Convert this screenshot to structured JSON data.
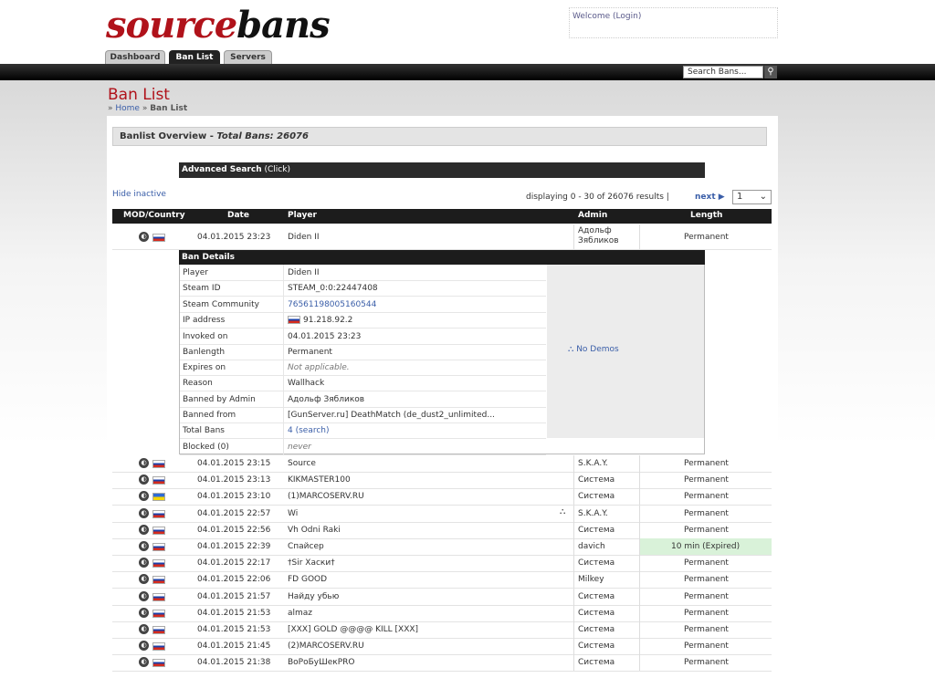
{
  "header": {
    "logo_part1": "source",
    "logo_part2": "bans",
    "welcome_prefix": "Welcome",
    "login_label": "(Login)",
    "tabs": [
      "Dashboard",
      "Ban List",
      "Servers"
    ],
    "search_placeholder": "Search Bans...",
    "search_icon": "magnifier-icon"
  },
  "page": {
    "title": "Ban List",
    "breadcrumb_home": "Home",
    "breadcrumb_current": "Ban List"
  },
  "overview": {
    "label": "Banlist Overview",
    "dash": " - ",
    "total": "Total Bans: 26076"
  },
  "advanced_search": {
    "label": "Advanced Search",
    "hint": "(Click)"
  },
  "controls": {
    "hide_inactive": "Hide inactive",
    "displaying": "displaying 0 - 30 of 26076 results |",
    "next": "next",
    "page_value": "1"
  },
  "table": {
    "headers": [
      "MOD/Country",
      "Date",
      "Player",
      "Admin",
      "Length"
    ],
    "first_row": {
      "flag": "ru",
      "date": "04.01.2015 23:23",
      "player": "Diden II",
      "admin": "Адольф Зябликов",
      "length": "Permanent"
    },
    "rows": [
      {
        "flag": "ru",
        "date": "04.01.2015 23:15",
        "player": "Source",
        "admin": "S.K.A.Y.",
        "length": "Permanent",
        "demo": false,
        "expired": false
      },
      {
        "flag": "ru",
        "date": "04.01.2015 23:13",
        "player": "KIKMASTER100",
        "admin": "Система",
        "length": "Permanent",
        "demo": false,
        "expired": false
      },
      {
        "flag": "ua",
        "date": "04.01.2015 23:10",
        "player": "(1)MARCOSERV.RU",
        "admin": "Система",
        "length": "Permanent",
        "demo": false,
        "expired": false
      },
      {
        "flag": "ru",
        "date": "04.01.2015 22:57",
        "player": "Wi",
        "admin": "S.K.A.Y.",
        "length": "Permanent",
        "demo": true,
        "expired": false
      },
      {
        "flag": "ru",
        "date": "04.01.2015 22:56",
        "player": "Vh Odni Raki",
        "admin": "Система",
        "length": "Permanent",
        "demo": false,
        "expired": false
      },
      {
        "flag": "ru",
        "date": "04.01.2015 22:39",
        "player": "Спайсер",
        "admin": "davich",
        "length": "10 min (Expired)",
        "demo": false,
        "expired": true
      },
      {
        "flag": "ru",
        "date": "04.01.2015 22:17",
        "player": "†Sir Хаски†",
        "admin": "Система",
        "length": "Permanent",
        "demo": false,
        "expired": false
      },
      {
        "flag": "ru",
        "date": "04.01.2015 22:06",
        "player": "FD GOOD",
        "admin": "Milkey",
        "length": "Permanent",
        "demo": false,
        "expired": false
      },
      {
        "flag": "ru",
        "date": "04.01.2015 21:57",
        "player": "Найду убью",
        "admin": "Система",
        "length": "Permanent",
        "demo": false,
        "expired": false
      },
      {
        "flag": "ru",
        "date": "04.01.2015 21:53",
        "player": "almaz",
        "admin": "Система",
        "length": "Permanent",
        "demo": false,
        "expired": false
      },
      {
        "flag": "ru",
        "date": "04.01.2015 21:53",
        "player": "[XXX] GOLD @@@@ KILL [XXX]",
        "admin": "Система",
        "length": "Permanent",
        "demo": false,
        "expired": false
      },
      {
        "flag": "ru",
        "date": "04.01.2015 21:45",
        "player": "(2)MARCOSERV.RU",
        "admin": "Система",
        "length": "Permanent",
        "demo": false,
        "expired": false
      },
      {
        "flag": "ru",
        "date": "04.01.2015 21:38",
        "player": "ВоРоБуШекPRO",
        "admin": "Система",
        "length": "Permanent",
        "demo": false,
        "expired": false
      }
    ]
  },
  "ban_details": {
    "title": "Ban Details",
    "fields": [
      {
        "key": "Player",
        "value": "Diden II"
      },
      {
        "key": "Steam ID",
        "value": "STEAM_0:0:22447408"
      },
      {
        "key": "Steam Community",
        "value": "76561198005160544"
      },
      {
        "key": "IP address",
        "value": "91.218.92.2"
      },
      {
        "key": "Invoked on",
        "value": "04.01.2015 23:23"
      },
      {
        "key": "Banlength",
        "value": "Permanent"
      },
      {
        "key": "Expires on",
        "value": "Not applicable."
      },
      {
        "key": "Reason",
        "value": "Wallhack"
      },
      {
        "key": "Banned by Admin",
        "value": "Адольф Зябликов"
      },
      {
        "key": "Banned from",
        "value": "[GunServer.ru] DeathMatch (de_dust2_unlimited..."
      },
      {
        "key": "Total Bans",
        "value": "4 (search)"
      },
      {
        "key": "Blocked (0)",
        "value": "never"
      }
    ],
    "no_demos": "No Demos"
  },
  "colors": {
    "brand_red": "#b0121a",
    "link_blue": "#3a5ea8",
    "expired_green": "#d9f2d9"
  }
}
